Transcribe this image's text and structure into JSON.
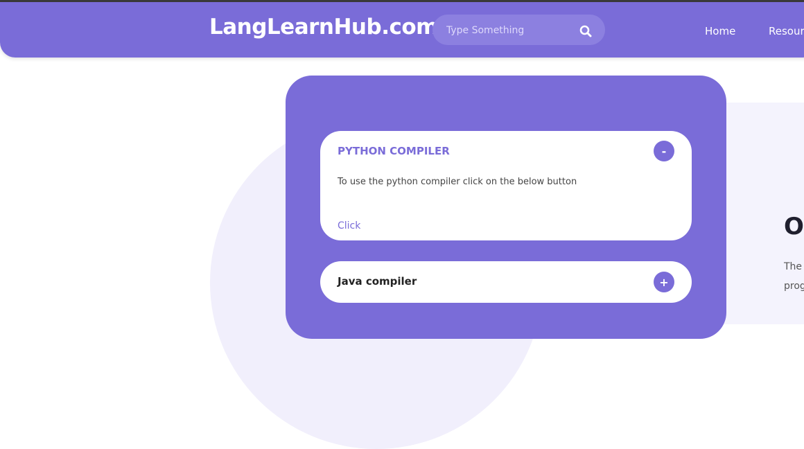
{
  "header": {
    "brand": "LangLearnHub.com",
    "search_placeholder": "Type Something",
    "nav": [
      "Home",
      "Resources"
    ]
  },
  "accordion": [
    {
      "title": "PYTHON COMPILER",
      "toggle": "-",
      "description": "To use the python compiler click on the below button",
      "link": "Click"
    },
    {
      "title": "Java compiler",
      "toggle": "+"
    }
  ],
  "right_section": {
    "heading": "O",
    "line1": "The",
    "line2": "prog"
  },
  "colors": {
    "accent": "#7a6cd8",
    "light_bg": "#f1effc"
  },
  "icons": {
    "search": "search-icon"
  }
}
